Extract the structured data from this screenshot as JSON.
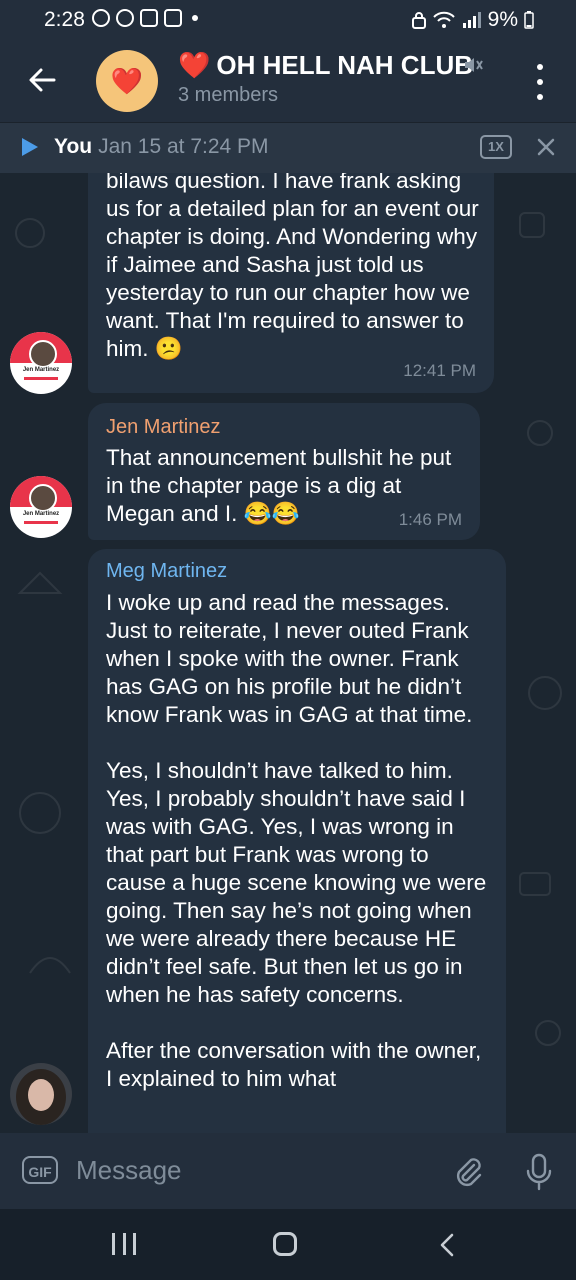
{
  "status_bar": {
    "time": "2:28",
    "battery": "9%"
  },
  "header": {
    "group_emoji": "❤️",
    "title_emoji": "❤️",
    "title": "OH HELL NAH CLUB",
    "subtitle": "3 members"
  },
  "audio_bar": {
    "sender": "You",
    "date": "Jan 15 at 7:24 PM",
    "speed": "1X"
  },
  "messages": [
    {
      "sender": "",
      "text": "bilaws question. I have frank asking us for a detailed plan for an event our chapter is doing. And Wondering why if Jaimee and Sasha just told us yesterday to run our chapter how we want. That I'm required to answer to him. 😕",
      "time": "12:41 PM",
      "avatar": "Jen Martinez"
    },
    {
      "sender": "Jen Martinez",
      "text": "That announcement bullshit he put in the chapter page is a dig at Megan and I. 😂😂",
      "time": "1:46 PM",
      "avatar": "Jen Martinez"
    },
    {
      "sender": "Meg Martinez",
      "text": "I woke up and read the messages. Just to reiterate, I never outed Frank when I spoke with the owner. Frank has GAG on his profile but he didn’t know Frank was in GAG at that time.\n\nYes, I shouldn’t have talked to him. Yes, I probably shouldn’t have said I was with GAG. Yes, I was wrong in that part but Frank was wrong to cause a huge scene knowing we were going. Then say he’s not going when we were already there because HE didn’t feel safe. But then let us go in when he has safety concerns.\n\nAfter the conversation with the owner, I explained to him what",
      "time": ""
    }
  ],
  "input": {
    "gif_label": "GIF",
    "placeholder": "Message"
  },
  "colors": {
    "header_bg": "#232e3c",
    "chat_bg": "#1c2630",
    "bubble_bg": "#243140",
    "jen_name": "#f0a070",
    "meg_name": "#6fb6f0",
    "accent": "#4c9ce8"
  },
  "icons": [
    "back-arrow-icon",
    "mute-icon",
    "more-vert-icon",
    "play-icon",
    "close-icon",
    "attach-icon",
    "mic-icon"
  ]
}
